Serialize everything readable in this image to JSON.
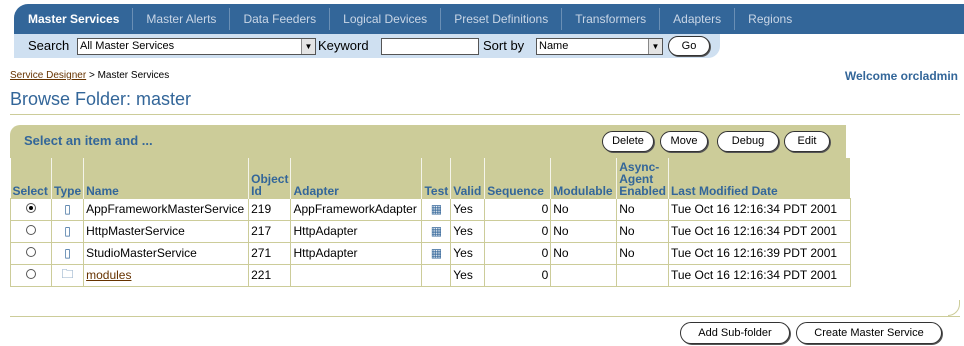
{
  "tabs": [
    {
      "label": "Master Services"
    },
    {
      "label": "Master Alerts"
    },
    {
      "label": "Data Feeders"
    },
    {
      "label": "Logical Devices"
    },
    {
      "label": "Preset Definitions"
    },
    {
      "label": "Transformers"
    },
    {
      "label": "Adapters"
    },
    {
      "label": "Regions"
    }
  ],
  "search": {
    "search_label": "Search",
    "search_value": "All Master Services",
    "keyword_label": "Keyword",
    "keyword_value": "",
    "sortby_label": "Sort by",
    "sortby_value": "Name",
    "go_label": "Go"
  },
  "breadcrumb": {
    "link": "Service Designer",
    "sep": ">",
    "current": "Master Services"
  },
  "welcome": "Welcome orcladmin",
  "page_title": "Browse Folder: master",
  "actions": {
    "prompt": "Select an item and ...",
    "delete": "Delete",
    "move": "Move",
    "debug": "Debug",
    "edit": "Edit"
  },
  "table": {
    "headers": {
      "select": "Select",
      "type": "Type",
      "name": "Name",
      "object_id_1": "Object",
      "object_id_2": "Id",
      "adapter": "Adapter",
      "test": "Test",
      "valid": "Valid",
      "sequence": "Sequence",
      "modulable": "Modulable",
      "async_1": "Async-",
      "async_2": "Agent",
      "async_3": "Enabled",
      "last_modified": "Last Modified Date"
    },
    "rows": [
      {
        "selected": true,
        "type": "service",
        "name": "AppFrameworkMasterService",
        "object_id": "219",
        "adapter": "AppFrameworkAdapter",
        "test": true,
        "valid": "Yes",
        "sequence": "0",
        "modulable": "No",
        "async": "No",
        "last_modified": "Tue Oct 16 12:16:34 PDT 2001"
      },
      {
        "selected": false,
        "type": "service",
        "name": "HttpMasterService",
        "object_id": "217",
        "adapter": "HttpAdapter",
        "test": true,
        "valid": "Yes",
        "sequence": "0",
        "modulable": "No",
        "async": "No",
        "last_modified": "Tue Oct 16 12:16:34 PDT 2001"
      },
      {
        "selected": false,
        "type": "service",
        "name": "StudioMasterService",
        "object_id": "271",
        "adapter": "HttpAdapter",
        "test": true,
        "valid": "Yes",
        "sequence": "0",
        "modulable": "No",
        "async": "No",
        "last_modified": "Tue Oct 16 12:16:39 PDT 2001"
      },
      {
        "selected": false,
        "type": "folder",
        "name": "modules",
        "object_id": "221",
        "adapter": "",
        "test": false,
        "valid": "Yes",
        "sequence": "0",
        "modulable": "",
        "async": "",
        "last_modified": "Tue Oct 16 12:16:34 PDT 2001"
      }
    ]
  },
  "bottom_actions": {
    "add_subfolder": "Add Sub-folder",
    "create_master": "Create Master Service"
  },
  "colors": {
    "tab_bar": "#336699",
    "search_strip": "#cfe0f1",
    "header_band": "#cccc99",
    "title": "#336699",
    "link": "#663300"
  }
}
